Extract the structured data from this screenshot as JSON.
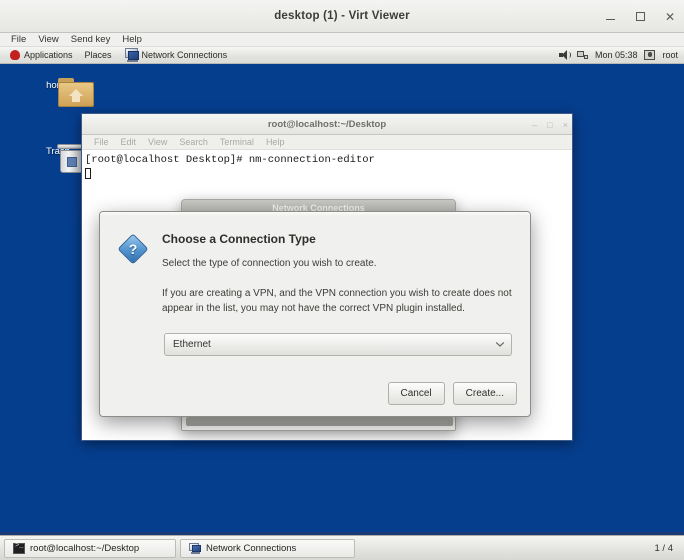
{
  "viewer": {
    "title": "desktop (1) - Virt Viewer",
    "window_controls": [
      {
        "name": "minimize-button",
        "glyph": "minimize"
      },
      {
        "name": "maximize-button",
        "glyph": "maximize"
      },
      {
        "name": "close-button",
        "glyph": "×"
      }
    ],
    "menu": [
      "File",
      "View",
      "Send key",
      "Help"
    ]
  },
  "gnome_panel": {
    "applications": "Applications",
    "places": "Places",
    "window_title": "Network Connections",
    "volume_icon": "speaker-icon",
    "network_icon": "network-icon",
    "clock": "Mon 05:38",
    "user": "root",
    "user_icon": "user-icon"
  },
  "desktop": {
    "background_color": "#063e8e",
    "icons": [
      {
        "label": "home",
        "icon": "home-folder-icon"
      },
      {
        "label": "Trash",
        "icon": "trash-icon"
      }
    ]
  },
  "terminal": {
    "title": "root@localhost:~/Desktop",
    "menu": [
      "File",
      "Edit",
      "View",
      "Search",
      "Terminal",
      "Help"
    ],
    "window_controls": [
      "–",
      "□",
      "×"
    ],
    "prompt_line": "[root@localhost Desktop]# nm-connection-editor"
  },
  "network_connections_window": {
    "title": "Network Connections"
  },
  "dialog": {
    "icon": "question-diamond-icon",
    "heading": "Choose a Connection Type",
    "subtitle": "Select the type of connection you wish to create.",
    "paragraph": "If you are creating a VPN, and the VPN connection you wish to create does not appear in the list, you may not have the correct VPN plugin installed.",
    "combo": {
      "selected": "Ethernet",
      "arrow_icon": "chevron-down-icon"
    },
    "buttons": {
      "cancel": "Cancel",
      "create": "Create..."
    }
  },
  "taskbar": {
    "items": [
      {
        "label": "root@localhost:~/Desktop",
        "icon": "terminal-icon"
      },
      {
        "label": "Network Connections",
        "icon": "network-connections-icon"
      }
    ],
    "workspace_counter": "1 / 4"
  }
}
